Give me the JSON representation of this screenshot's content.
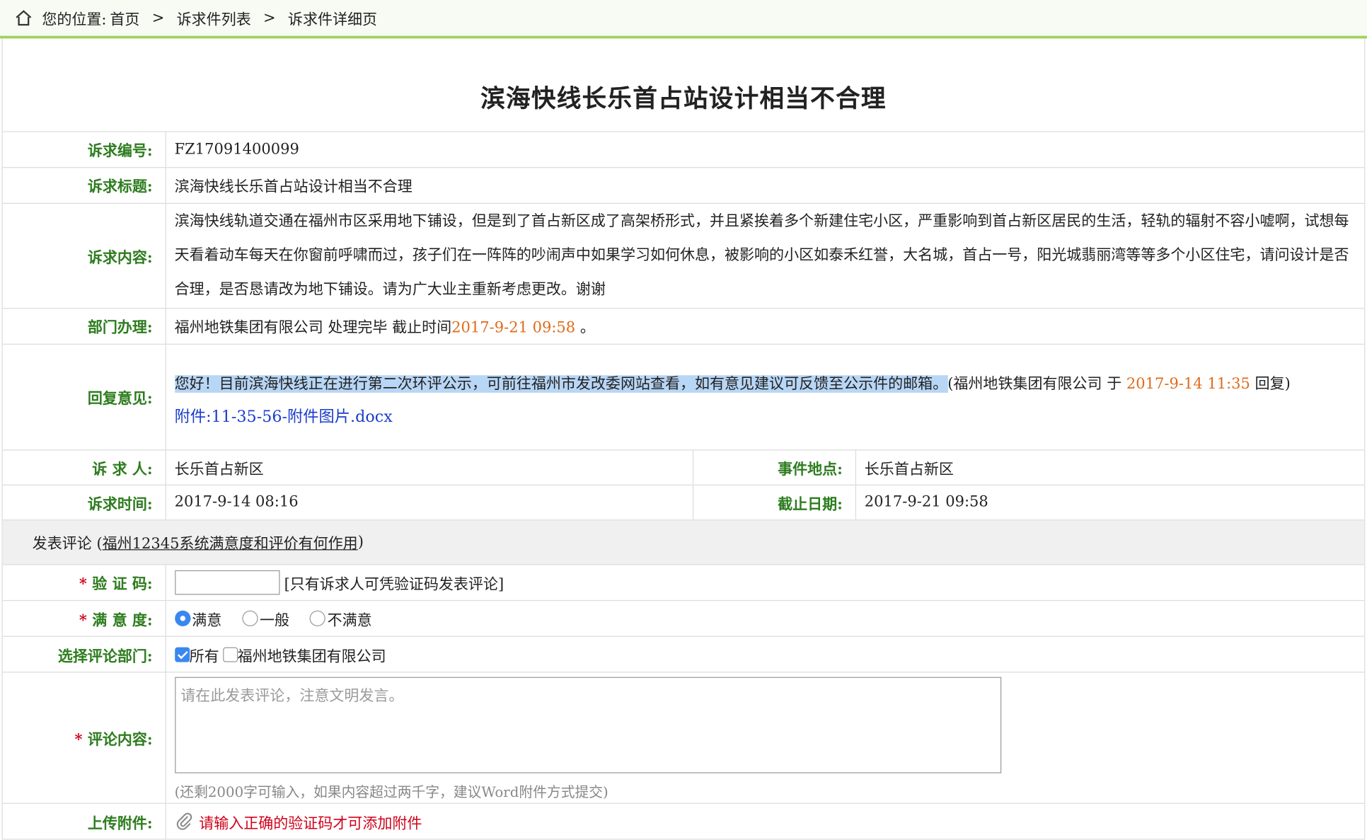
{
  "breadcrumb": {
    "prefix": "您的位置:",
    "items": [
      "首页",
      "诉求件列表",
      "诉求件详细页"
    ],
    "separator": ">"
  },
  "title": "滨海快线长乐首占站设计相当不合理",
  "details": {
    "number_label": "诉求编号:",
    "number": "FZ17091400099",
    "subject_label": "诉求标题:",
    "subject": "滨海快线长乐首占站设计相当不合理",
    "content_label": "诉求内容:",
    "content": "滨海快线轨道交通在福州市区采用地下铺设，但是到了首占新区成了高架桥形式，并且紧挨着多个新建住宅小区，严重影响到首占新区居民的生活，轻轨的辐射不容小嘘啊，试想每天看着动车每天在你窗前呼啸而过，孩子们在一阵阵的吵闹声中如果学习如何休息，被影响的小区如泰禾红誉，大名城，首占一号，阳光城翡丽湾等等多个小区住宅，请问设计是否合理，是否恳请改为地下铺设。请为广大业主重新考虑更改。谢谢",
    "dept_label": "部门办理:",
    "dept_text": "福州地铁集团有限公司  处理完毕 截止时间",
    "dept_deadline": "2017-9-21 09:58",
    "dept_suffix": " 。",
    "reply_label": "回复意见:",
    "reply_text": "您好！目前滨海快线正在进行第二次环评公示，可前往福州市发改委网站查看，如有意见建议可反馈至公示件的邮箱。",
    "reply_by_prefix": "(福州地铁集团有限公司  于 ",
    "reply_time": "2017-9-14 11:35",
    "reply_by_suffix": "  回复)",
    "attachment": "附件:11-35-56-附件图片.docx",
    "petitioner_label": "诉 求 人:",
    "petitioner": "长乐首占新区",
    "location_label": "事件地点:",
    "location": "长乐首占新区",
    "time_label": "诉求时间:",
    "time": "2017-9-14 08:16",
    "deadline_label": "截止日期:",
    "deadline": "2017-9-21 09:58"
  },
  "comment": {
    "section_title": "发表评论 (",
    "section_link": "福州12345系统满意度和评价有何作用",
    "section_close": ")",
    "code_label": "验 证 码:",
    "code_value": "",
    "code_hint": "[只有诉求人可凭验证码发表评论]",
    "satisfaction_label": "满 意 度:",
    "satisfaction_options": [
      "满意",
      "一般",
      "不满意"
    ],
    "satisfaction_selected": "满意",
    "dept_select_label": "选择评论部门:",
    "dept_options": [
      "所有",
      "福州地铁集团有限公司"
    ],
    "content_label": "评论内容:",
    "content_placeholder": "请在此发表评论，注意文明发言。",
    "content_hint": "(还剩2000字可输入，如果内容超过两千字，建议Word附件方式提交)",
    "upload_label": "上传附件:",
    "upload_warning": "请输入正确的验证码才可添加附件",
    "required_mark": "*"
  },
  "colors": {
    "label_green": "#2e7d1f",
    "accent_orange": "#e06b1a",
    "warning_red": "#d0021b",
    "link_blue": "#1a3ccc",
    "breadcrumb_border": "#9fd35a"
  }
}
